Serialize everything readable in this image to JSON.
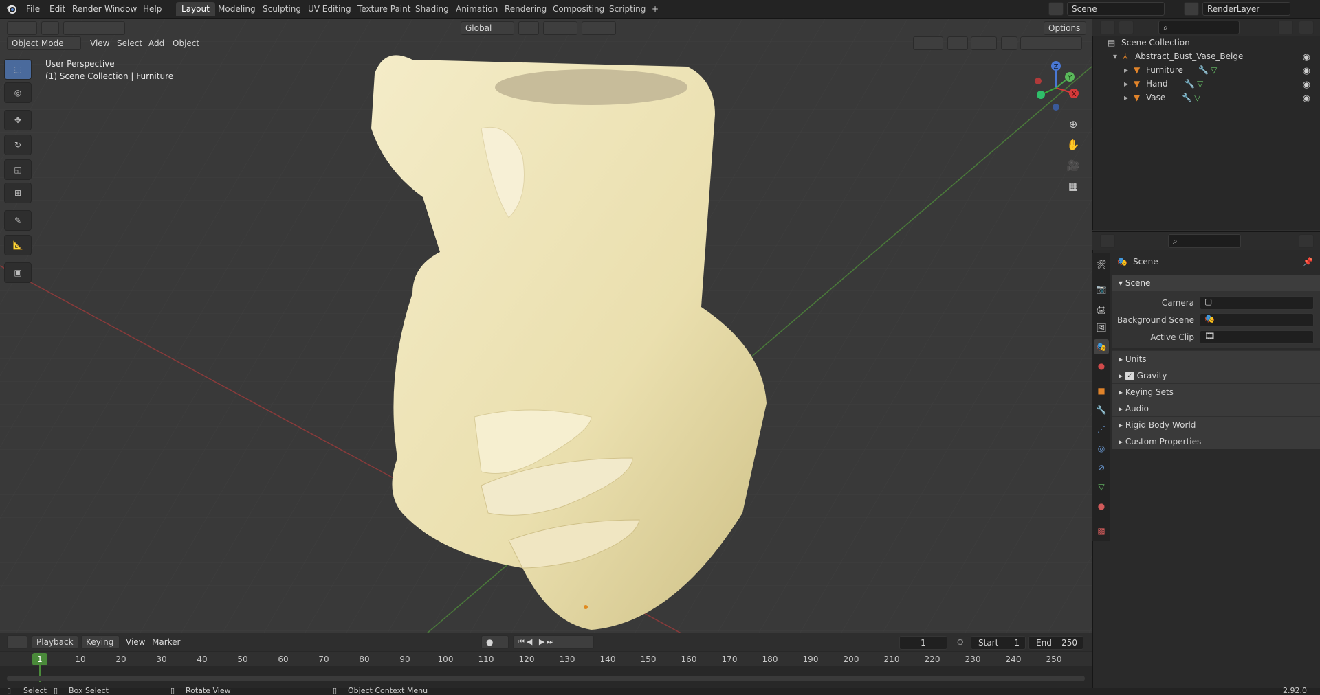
{
  "topbar": {
    "menus": [
      "File",
      "Edit",
      "Render",
      "Window",
      "Help"
    ],
    "workspaces": [
      "Layout",
      "Modeling",
      "Sculpting",
      "UV Editing",
      "Texture Paint",
      "Shading",
      "Animation",
      "Rendering",
      "Compositing",
      "Scripting"
    ],
    "active_workspace": "Layout",
    "add_tab": "+",
    "scene_name": "Scene",
    "view_layer": "RenderLayer"
  },
  "viewport": {
    "mode": "Object Mode",
    "menus": [
      "View",
      "Select",
      "Add",
      "Object"
    ],
    "transform_orientation": "Global",
    "options_label": "Options",
    "overlay_line1": "User Perspective",
    "overlay_line2": "(1) Scene Collection | Furniture",
    "gizmo": {
      "x": "X",
      "y": "Y",
      "z": "Z"
    }
  },
  "outliner": {
    "root": "Scene Collection",
    "collection": "Abstract_Bust_Vase_Beige",
    "objects": [
      "Furniture",
      "Hand",
      "Vase"
    ]
  },
  "properties": {
    "context": "Scene",
    "section": "Scene",
    "labels": {
      "camera": "Camera",
      "background_scene": "Background Scene",
      "active_clip": "Active Clip"
    },
    "subpanels": [
      "Units",
      "Gravity",
      "Keying Sets",
      "Audio",
      "Rigid Body World",
      "Custom Properties"
    ],
    "gravity_enabled": true
  },
  "timeline": {
    "menus": [
      "Playback",
      "Keying",
      "View",
      "Marker"
    ],
    "current_frame": "1",
    "start_label": "Start",
    "start": "1",
    "end_label": "End",
    "end": "250",
    "ruler": [
      "10",
      "20",
      "30",
      "40",
      "50",
      "60",
      "70",
      "80",
      "90",
      "100",
      "110",
      "120",
      "130",
      "140",
      "150",
      "160",
      "170",
      "180",
      "190",
      "200",
      "210",
      "220",
      "230",
      "240",
      "250"
    ],
    "playhead": "1"
  },
  "statusbar": {
    "select": "Select",
    "box_select": "Box Select",
    "rotate_view": "Rotate View",
    "context_menu": "Object Context Menu",
    "version": "2.92.0"
  }
}
